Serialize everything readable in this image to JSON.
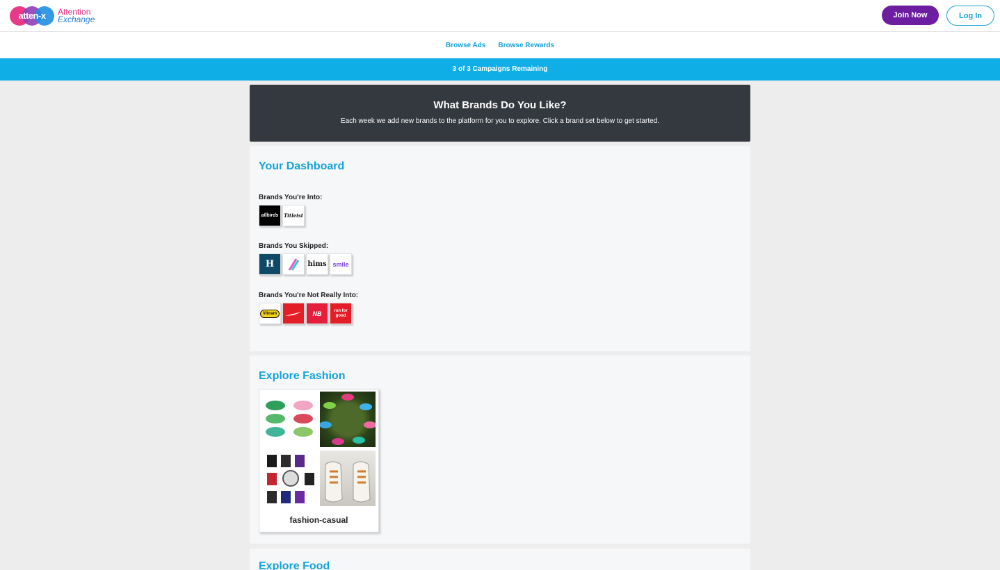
{
  "header": {
    "logo_mark": "atten-x",
    "logo_word1": "Attention",
    "logo_word2": "Exchange",
    "join_label": "Join Now",
    "login_label": "Log In"
  },
  "subnav": {
    "browse_ads": "Browse Ads",
    "browse_rewards": "Browse Rewards"
  },
  "banner": {
    "text": "3 of 3 Campaigns Remaining"
  },
  "hero": {
    "title": "What Brands Do You Like?",
    "subtitle": "Each week we add new brands to the platform for you to explore. Click a brand set below to get started."
  },
  "dashboard": {
    "title": "Your Dashboard",
    "into_label": "Brands You're Into:",
    "skipped_label": "Brands You Skipped:",
    "not_into_label": "Brands You're Not Really Into:",
    "into": [
      "allbirds",
      "Titleist"
    ],
    "skipped": [
      "H",
      "",
      "hims",
      "smile"
    ],
    "not_into": [
      "Vibram",
      "",
      "NB",
      "run for good"
    ]
  },
  "fashion": {
    "title": "Explore Fashion",
    "card_label": "fashion-casual"
  },
  "food": {
    "title": "Explore Food"
  },
  "colors": {
    "accent": "#14a2d9",
    "join": "#6c1da0",
    "banner": "#10aee7",
    "hero": "#34393f"
  }
}
